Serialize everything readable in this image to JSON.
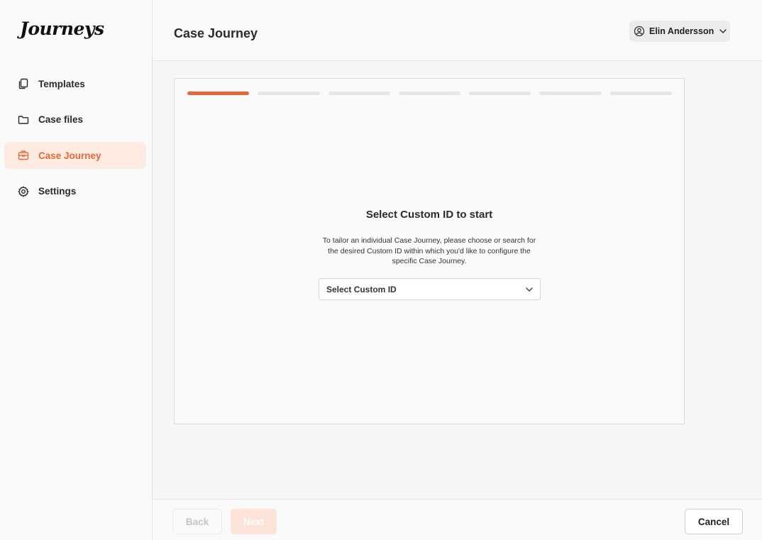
{
  "app": {
    "logo": "Journeys"
  },
  "sidebar": {
    "items": [
      {
        "label": "Templates",
        "icon": "templates-icon"
      },
      {
        "label": "Case files",
        "icon": "folder-icon"
      },
      {
        "label": "Case Journey",
        "icon": "briefcase-icon",
        "active": true
      },
      {
        "label": "Settings",
        "icon": "gear-icon"
      }
    ]
  },
  "header": {
    "title": "Case Journey",
    "user": {
      "name": "Elin Andersson",
      "icon": "user-circle-icon"
    }
  },
  "main": {
    "progress": {
      "total_steps": 7,
      "current_step": 1
    },
    "title": "Select Custom ID to start",
    "description": "To tailor an individual Case Journey, please choose or search for the desired Custom ID within which you'd like to configure the specific Case Journey.",
    "select": {
      "placeholder": "Select Custom ID"
    }
  },
  "footer": {
    "back_label": "Back",
    "next_label": "Next",
    "cancel_label": "Cancel"
  },
  "colors": {
    "accent": "#e4683a",
    "active_bg": "#fdebe2",
    "next_disabled_bg": "#fde3d8"
  }
}
